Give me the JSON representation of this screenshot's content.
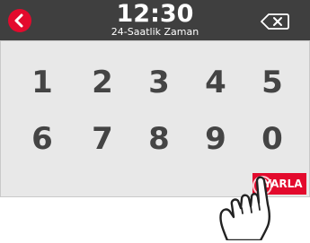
{
  "header": {
    "time": "12:30",
    "subtitle": "24-Saatlik Zaman",
    "back_icon": "chevron-left-icon",
    "backspace_icon": "backspace-icon"
  },
  "keypad": {
    "keys": [
      "1",
      "2",
      "3",
      "4",
      "5",
      "6",
      "7",
      "8",
      "9",
      "0"
    ]
  },
  "actions": {
    "save_label": "AYARLA"
  },
  "colors": {
    "accent": "#e30a2d",
    "header_bg": "#3f3f3f",
    "keypad_bg": "#e8e8e8",
    "key_text": "#444444"
  }
}
